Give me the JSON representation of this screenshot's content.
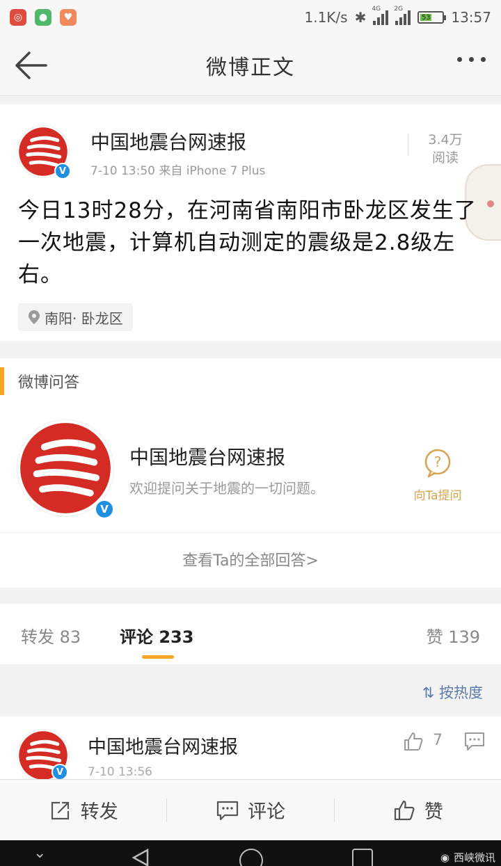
{
  "status_bar": {
    "speed": "1.1K/s",
    "net1": "4G",
    "net2": "2G",
    "battery": "53",
    "time": "13:57"
  },
  "nav": {
    "title": "微博正文"
  },
  "post": {
    "author": "中国地震台网速报",
    "meta": "7-10 13:50  来自 iPhone 7 Plus",
    "reads_count": "3.4万",
    "reads_label": "阅读",
    "text": "今日13时28分，在河南省南阳市卧龙区发生了一次地震，计算机自动测定的震级是2.8级左右。",
    "location": "南阳· 卧龙区"
  },
  "qa": {
    "title": "微博问答",
    "name": "中国地震台网速报",
    "desc": "欢迎提问关于地震的一切问题。",
    "ask_label": "向Ta提问",
    "view_all": "查看Ta的全部回答>"
  },
  "tabs": {
    "repost": "转发 83",
    "comments": "评论 233",
    "likes": "赞 139"
  },
  "sort_label": "按热度",
  "comment": {
    "author": "中国地震台网速报",
    "time": "7-10 13:56",
    "like_count": "7"
  },
  "toolbar": {
    "repost": "转发",
    "comment": "评论",
    "like": "赞"
  },
  "watermark": "西峡微讯",
  "colors": {
    "accent": "#f6a623",
    "logo_red": "#d42b24",
    "verified_blue": "#1f8fe0",
    "link_blue": "#5b7ba8"
  }
}
